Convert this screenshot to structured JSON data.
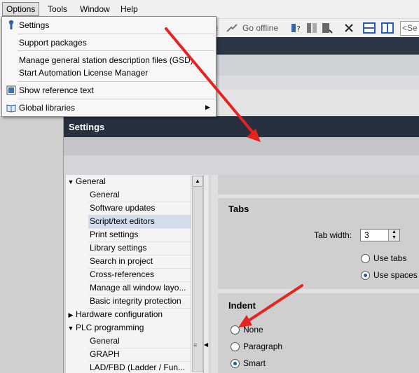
{
  "menubar": {
    "items": [
      "Options",
      "Tools",
      "Window",
      "Help"
    ]
  },
  "toolbar": {
    "go_offline": "Go offline",
    "search_placeholder": "<Se"
  },
  "dropdown": {
    "items": [
      "Settings",
      "Support packages",
      "Manage general station description files (GSD)",
      "Start Automation License Manager",
      "Show reference text",
      "Global libraries"
    ]
  },
  "settings": {
    "title": "Settings",
    "tree": [
      {
        "label": "General",
        "level": 0,
        "expanded": true
      },
      {
        "label": "General",
        "level": 1
      },
      {
        "label": "Software updates",
        "level": 1
      },
      {
        "label": "Script/text editors",
        "level": 1,
        "selected": true
      },
      {
        "label": "Print settings",
        "level": 1
      },
      {
        "label": "Library settings",
        "level": 1
      },
      {
        "label": "Search in project",
        "level": 1
      },
      {
        "label": "Cross-references",
        "level": 1
      },
      {
        "label": "Manage all window layo...",
        "level": 1
      },
      {
        "label": "Basic integrity protection",
        "level": 1
      },
      {
        "label": "Hardware configuration",
        "level": 0,
        "expanded": false
      },
      {
        "label": "PLC programming",
        "level": 0,
        "expanded": true
      },
      {
        "label": "General",
        "level": 1
      },
      {
        "label": "GRAPH",
        "level": 1
      },
      {
        "label": "LAD/FBD (Ladder / Fun...",
        "level": 1
      }
    ],
    "tabs": {
      "title": "Tabs",
      "tab_width_label": "Tab width:",
      "tab_width_value": "3",
      "use_tabs": "Use tabs",
      "use_spaces": "Use spaces",
      "selected": "use_spaces"
    },
    "indent": {
      "title": "Indent",
      "none": "None",
      "paragraph": "Paragraph",
      "smart": "Smart",
      "selected": "smart"
    }
  },
  "colors": {
    "title_bar": "#27303f",
    "annotation_arrow": "#e8231f",
    "selection": "#d2dceb"
  }
}
